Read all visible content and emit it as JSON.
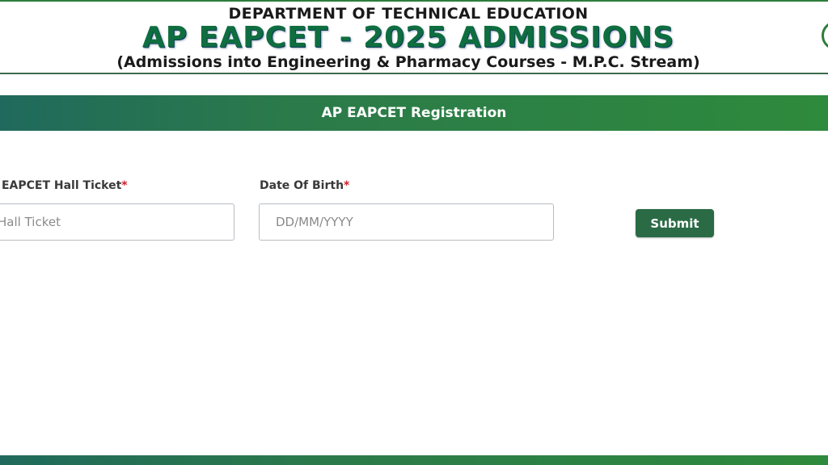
{
  "header": {
    "department": "DEPARTMENT OF TECHNICAL EDUCATION",
    "title": "AP EAPCET - 2025 ADMISSIONS",
    "subtitle": "(Admissions into Engineering & Pharmacy Courses - M.P.C. Stream)"
  },
  "banner": {
    "title": "AP EAPCET Registration"
  },
  "form": {
    "hall_ticket": {
      "label": "AP EAPCET Hall Ticket",
      "required_mark": "*",
      "placeholder": "Hall Ticket"
    },
    "dob": {
      "label": "Date Of Birth",
      "required_mark": "*",
      "placeholder": "DD/MM/YYYY"
    },
    "submit_label": "Submit"
  },
  "colors": {
    "brand_green": "#2e7d3a",
    "button_green": "#2a6b45",
    "required_red": "#d0202a"
  }
}
